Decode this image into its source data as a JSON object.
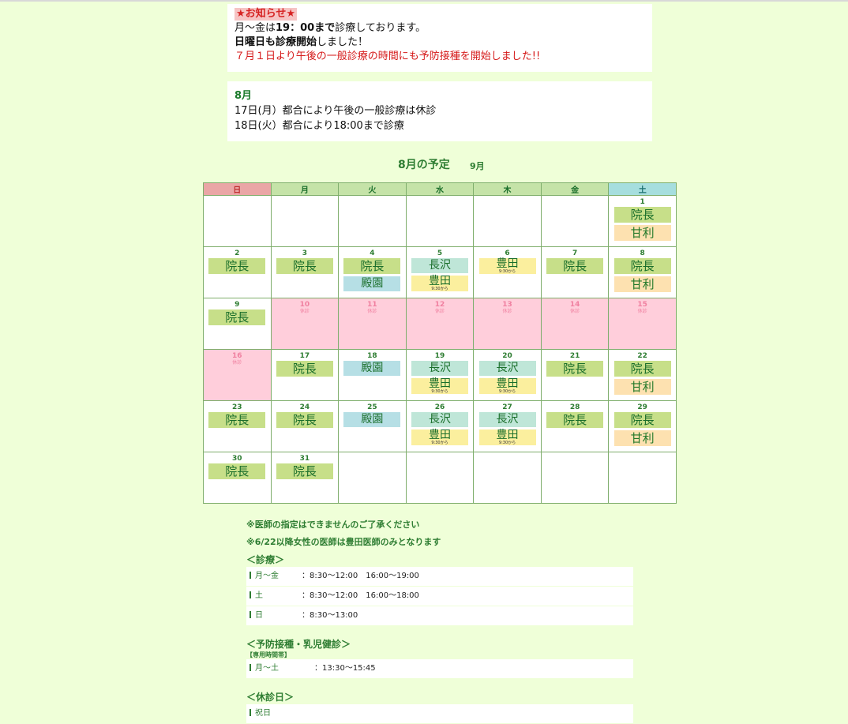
{
  "notice": {
    "title": "★お知らせ★",
    "line1_pre": "月～金は",
    "line1_bold": "19：00まで",
    "line1_post": "診療しております。",
    "line2_bold": "日曜日も診療開始",
    "line2_post": "しました！",
    "line3": "７月１日より午後の一般診療の時間にも予防接種を開始しました!!"
  },
  "august_notice": {
    "heading": "8月",
    "lines": [
      "17日(月）都合により午後の一般診療は休診",
      "18日(火）都合により18:00まで診療"
    ]
  },
  "calendar": {
    "title": "8月の予定",
    "next_month": "9月",
    "weekdays": [
      "日",
      "月",
      "火",
      "水",
      "木",
      "金",
      "土"
    ],
    "holiday_text": "休診",
    "time_note": "9:30から",
    "weeks": [
      [
        null,
        null,
        null,
        null,
        null,
        null,
        {
          "d": "1",
          "docs": [
            "院長",
            "甘利"
          ]
        }
      ],
      [
        {
          "d": "2",
          "docs": [
            "院長"
          ]
        },
        {
          "d": "3",
          "docs": [
            "院長"
          ]
        },
        {
          "d": "4",
          "docs": [
            "院長",
            "殿園"
          ]
        },
        {
          "d": "5",
          "docs": [
            "長沢",
            "豊田"
          ]
        },
        {
          "d": "6",
          "docs": [
            "豊田"
          ]
        },
        {
          "d": "7",
          "docs": [
            "院長"
          ]
        },
        {
          "d": "8",
          "docs": [
            "院長",
            "甘利"
          ]
        }
      ],
      [
        {
          "d": "9",
          "docs": [
            "院長"
          ]
        },
        {
          "d": "10",
          "hol": true
        },
        {
          "d": "11",
          "hol": true
        },
        {
          "d": "12",
          "hol": true
        },
        {
          "d": "13",
          "hol": true
        },
        {
          "d": "14",
          "hol": true
        },
        {
          "d": "15",
          "hol": true
        }
      ],
      [
        {
          "d": "16",
          "hol": true
        },
        {
          "d": "17",
          "docs": [
            "院長"
          ]
        },
        {
          "d": "18",
          "docs": [
            "殿園"
          ]
        },
        {
          "d": "19",
          "docs": [
            "長沢",
            "豊田"
          ]
        },
        {
          "d": "20",
          "docs": [
            "長沢",
            "豊田"
          ]
        },
        {
          "d": "21",
          "docs": [
            "院長"
          ]
        },
        {
          "d": "22",
          "docs": [
            "院長",
            "甘利"
          ]
        }
      ],
      [
        {
          "d": "23",
          "docs": [
            "院長"
          ]
        },
        {
          "d": "24",
          "docs": [
            "院長"
          ]
        },
        {
          "d": "25",
          "docs": [
            "殿園"
          ]
        },
        {
          "d": "26",
          "docs": [
            "長沢",
            "豊田"
          ]
        },
        {
          "d": "27",
          "docs": [
            "長沢",
            "豊田"
          ]
        },
        {
          "d": "28",
          "docs": [
            "院長"
          ]
        },
        {
          "d": "29",
          "docs": [
            "院長",
            "甘利"
          ]
        }
      ],
      [
        {
          "d": "30",
          "docs": [
            "院長"
          ]
        },
        {
          "d": "31",
          "docs": [
            "院長"
          ]
        },
        null,
        null,
        null,
        null,
        null
      ]
    ]
  },
  "notes": [
    "※医師の指定はできませんのご了承ください",
    "※6/22以降女性の医師は豊田医師のみとなります"
  ],
  "clinic": {
    "heading": "＜診療＞",
    "rows": [
      {
        "label": "月～金",
        "value": "：8:30～12:00　16:00～19:00"
      },
      {
        "label": "土",
        "value": "：8:30～12:00　16:00～18:00"
      },
      {
        "label": "日",
        "value": "：8:30～13:00"
      }
    ]
  },
  "vaccine": {
    "heading": "＜予防接種・乳児健診＞",
    "sub": "【専用時間帯】",
    "rows": [
      {
        "label": "月～土",
        "value": "：13:30～15:45"
      }
    ]
  },
  "closed": {
    "heading": "＜休診日＞",
    "rows": [
      {
        "label": "祝日",
        "value": ""
      }
    ]
  }
}
